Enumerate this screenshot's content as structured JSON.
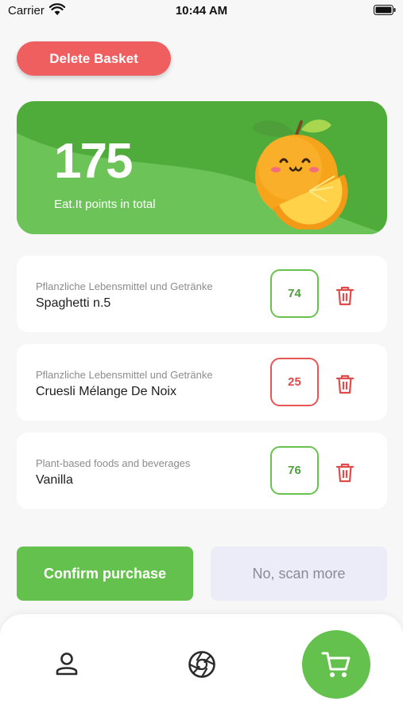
{
  "status_bar": {
    "carrier": "Carrier",
    "time": "10:44 AM"
  },
  "header": {
    "delete_basket_label": "Delete Basket"
  },
  "points_card": {
    "total": "175",
    "caption": "Eat.It points in total"
  },
  "basket": {
    "items": [
      {
        "category": "Pflanzliche Lebensmittel und Getränke",
        "name": "Spaghetti n.5",
        "points": "74",
        "status": "green"
      },
      {
        "category": "Pflanzliche Lebensmittel und Getränke",
        "name": "Cruesli Mélange De Noix",
        "points": "25",
        "status": "red"
      },
      {
        "category": "Plant-based foods and beverages",
        "name": "Vanilla",
        "points": "76",
        "status": "green"
      }
    ]
  },
  "actions": {
    "confirm_label": "Confirm purchase",
    "scan_more_label": "No, scan more"
  },
  "nav": {
    "items": [
      {
        "icon": "profile-icon"
      },
      {
        "icon": "camera-shutter-icon"
      },
      {
        "icon": "cart-icon",
        "active": true
      }
    ]
  },
  "colors": {
    "accent_green": "#65c14d",
    "danger_red": "#ef5f5f"
  }
}
